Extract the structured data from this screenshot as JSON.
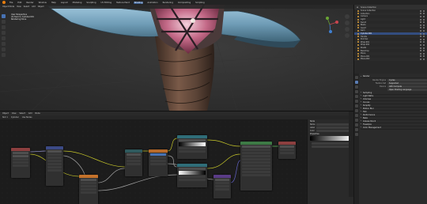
{
  "topbar": {
    "menus": [
      "File",
      "Edit",
      "Render",
      "Window",
      "Help"
    ],
    "workspaces": [
      "Layout",
      "Modeling",
      "Sculpting",
      "UV Editing",
      "Texture Paint",
      "Shading",
      "Animation",
      "Rendering",
      "Compositing",
      "Scripting"
    ],
    "active_workspace": "Shading"
  },
  "viewport": {
    "header_items": [
      "Object Mode",
      "View",
      "Select",
      "Add",
      "Object"
    ],
    "info_lines": [
      "User Perspective",
      "(0) Sword | Cylinder.001",
      "Rendering Done"
    ]
  },
  "outliner": {
    "header": "Scene Collection",
    "rows": [
      {
        "label": "Scene Collection",
        "selected": false
      },
      {
        "label": "Collection",
        "selected": false
      },
      {
        "label": "Camera",
        "selected": false
      },
      {
        "label": "Light",
        "selected": false
      },
      {
        "label": "Sword",
        "selected": false
      },
      {
        "label": "Blade",
        "selected": false
      },
      {
        "label": "Guard",
        "selected": false
      },
      {
        "label": "Gem",
        "selected": false
      },
      {
        "label": "Cylinder.001",
        "selected": true
      },
      {
        "label": "Handle",
        "selected": false
      },
      {
        "label": "Pommel",
        "selected": false
      },
      {
        "label": "Wrap.001",
        "selected": false
      },
      {
        "label": "Wrap.002",
        "selected": false
      },
      {
        "label": "Rivets",
        "selected": false
      },
      {
        "label": "Backdrop",
        "selected": false
      },
      {
        "label": "Plane",
        "selected": false
      },
      {
        "label": "Plane.001",
        "selected": false
      },
      {
        "label": "Plane.002",
        "selected": false
      }
    ]
  },
  "properties": {
    "sections": [
      {
        "title": "Render",
        "rows": [
          [
            "Render Engine",
            "Cycles"
          ],
          [
            "Feature Set",
            "Supported"
          ],
          [
            "Device",
            "GPU Compute"
          ],
          [
            "",
            "Open Shading Language"
          ]
        ]
      },
      {
        "title": "Sampling",
        "rows": []
      },
      {
        "title": "Light Paths",
        "rows": []
      },
      {
        "title": "Volumes",
        "rows": []
      },
      {
        "title": "Curves",
        "rows": []
      },
      {
        "title": "Simplify",
        "rows": []
      },
      {
        "title": "Motion Blur",
        "rows": []
      },
      {
        "title": "Film",
        "rows": []
      },
      {
        "title": "Performance",
        "rows": []
      },
      {
        "title": "Bake",
        "rows": []
      },
      {
        "title": "Grease Pencil",
        "rows": []
      },
      {
        "title": "Freestyle",
        "rows": []
      },
      {
        "title": "Color Management",
        "rows": []
      }
    ]
  },
  "node_editor": {
    "header_items": [
      "Object",
      "View",
      "Select",
      "Add",
      "Node"
    ],
    "header2_items": [
      "Slot 1",
      "Cylinder",
      "Use Nodes"
    ],
    "npanel": {
      "sections": [
        "Node",
        "Properties"
      ],
      "name_label": "Name",
      "label_label": "Label",
      "color_label": "Color"
    }
  }
}
